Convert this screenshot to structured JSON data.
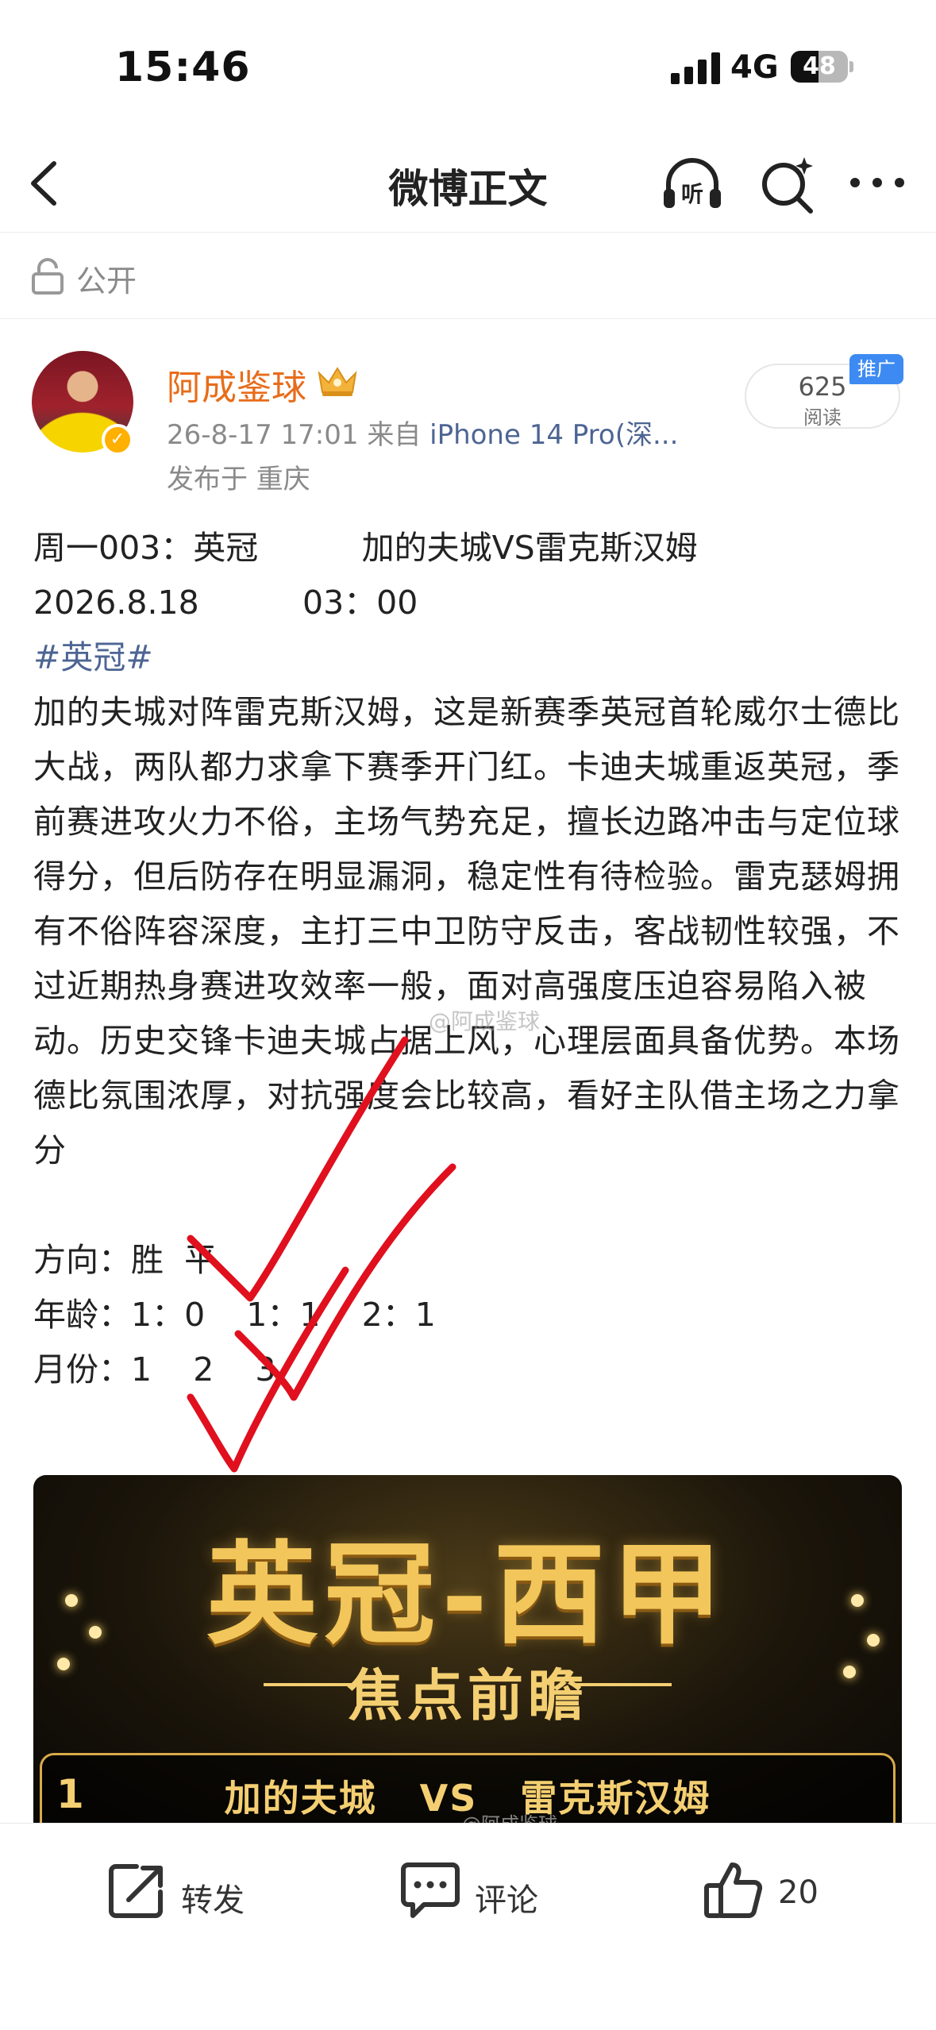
{
  "status_bar": {
    "time": "15:46",
    "network": "4G",
    "battery_level": "48",
    "battery_fraction": 0.48
  },
  "nav": {
    "title": "微博正文",
    "back_icon": "chevron-left-icon",
    "listen_icon": "listen-icon",
    "listen_label": "听",
    "search_icon": "search-sparkle-icon",
    "more_icon": "more-icon"
  },
  "visibility": {
    "label": "公开",
    "icon": "lock-icon"
  },
  "post": {
    "author": "阿成鉴球",
    "meta_time": "26-8-17 17:01",
    "meta_from": "来自",
    "meta_source": "iPhone 14 Pro(深...",
    "location": "发布于 重庆",
    "views_count": "625",
    "views_label": "阅读",
    "promo_badge": "推广",
    "header_line1": "周一003：英冠          加的夫城VS雷克斯汉姆",
    "header_line2": "2026.8.18          03：00",
    "hashtag": "#英冠#",
    "paragraph": "加的夫城对阵雷克斯汉姆，这是新赛季英冠首轮威尔士德比大战，两队都力求拿下赛季开门红。卡迪夫城重返英冠，季前赛进攻火力不俗，主场气势充足，擅长边路冲击与定位球得分，但后防存在明显漏洞，稳定性有待检验。雷克瑟姆拥有不俗阵容深度，主打三中卫防守反击，客战韧性较强，不过近期热身赛进攻效率一般，面对高强度压迫容易陷入被动。历史交锋卡迪夫城占据上风，心理层面具备优势。本场德比氛围浓厚，对抗强度会比较高，看好主队借主场之力拿分",
    "direction": "方向：胜  平",
    "age": "年龄：1：0    1：1    2：1",
    "month": "月份：1    2    3",
    "watermark": "@阿成鉴球"
  },
  "image": {
    "title": "英冠-西甲",
    "subtitle": "焦点前瞻",
    "row_number": "1",
    "match": "加的夫城   VS   雷克斯汉姆",
    "watermark": "@阿成鉴球"
  },
  "actions": {
    "repost_label": "转发",
    "comment_label": "评论",
    "like_count": "20"
  },
  "colors": {
    "author": "#e86c1a",
    "link": "#4d6593",
    "promo": "#3d8bf2",
    "scribble": "#e0101e",
    "gold": "#f2c65a"
  }
}
